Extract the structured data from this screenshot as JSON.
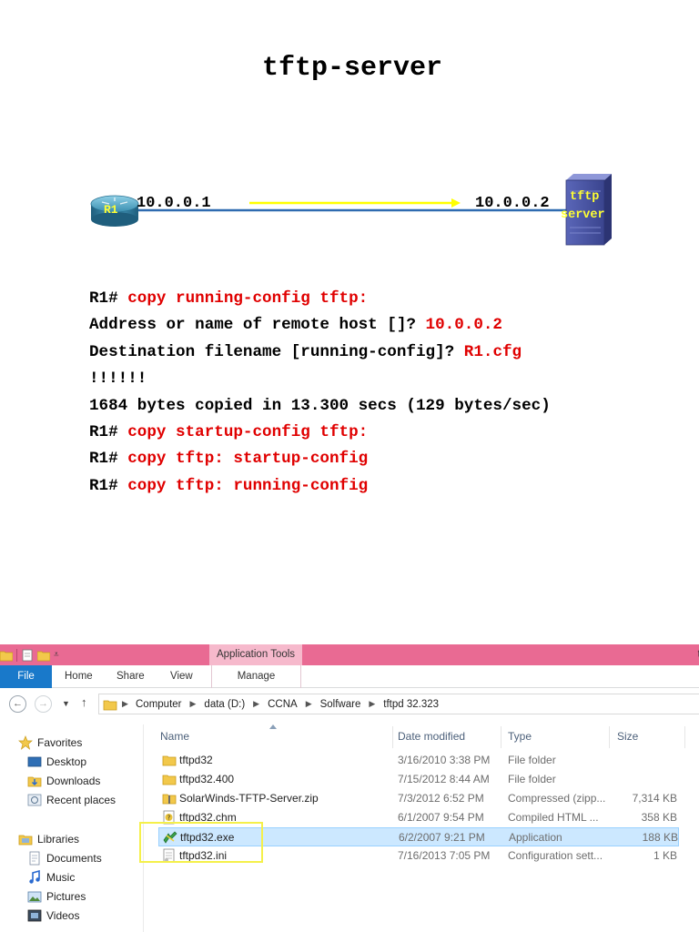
{
  "slide": {
    "title": "tftp-server",
    "diagram": {
      "router_label": "R1",
      "router_ip": "10.0.0.1",
      "server_ip": "10.0.0.2",
      "server_label_line1": "tftp",
      "server_label_line2": "server",
      "link_color": "#2f6bb0",
      "arrow_color": "#ffff00"
    },
    "cli": [
      {
        "prompt": "R1# ",
        "text": "copy running-config tftp:",
        "style": "command"
      },
      {
        "prompt": "Address or name of remote host []? ",
        "text": "10.0.0.2",
        "style": "command"
      },
      {
        "prompt": "Destination filename [running-config]? ",
        "text": "R1.cfg",
        "style": "command"
      },
      {
        "prompt": "!!!!!!",
        "text": "",
        "style": "output"
      },
      {
        "prompt": "1684 bytes copied in 13.300 secs (129 bytes/sec)",
        "text": "",
        "style": "output"
      },
      {
        "prompt": "R1# ",
        "text": "copy startup-config tftp:",
        "style": "command"
      },
      {
        "prompt": "R1# ",
        "text": "copy tftp: startup-config",
        "style": "command"
      },
      {
        "prompt": "R1# ",
        "text": "copy tftp: running-config",
        "style": "command"
      }
    ]
  },
  "explorer": {
    "context_tab": "Application Tools",
    "title_tail": "t",
    "ribbon_tabs": {
      "file": "File",
      "home": "Home",
      "share": "Share",
      "view": "View",
      "manage": "Manage"
    },
    "breadcrumbs": [
      "Computer",
      "data (D:)",
      "CCNA",
      "Solfware",
      "tftpd 32.323"
    ],
    "nav": {
      "favorites": "Favorites",
      "desktop": "Desktop",
      "downloads": "Downloads",
      "recent": "Recent places",
      "libraries": "Libraries",
      "documents": "Documents",
      "music": "Music",
      "pictures": "Pictures",
      "videos": "Videos"
    },
    "columns": {
      "name": "Name",
      "date": "Date modified",
      "type": "Type",
      "size": "Size"
    },
    "files": [
      {
        "name": "tftpd32",
        "date": "3/16/2010 3:38 PM",
        "type": "File folder",
        "size": "",
        "icon": "folder-icon",
        "selected": false
      },
      {
        "name": "tftpd32.400",
        "date": "7/15/2012 8:44 AM",
        "type": "File folder",
        "size": "",
        "icon": "folder-icon",
        "selected": false
      },
      {
        "name": "SolarWinds-TFTP-Server.zip",
        "date": "7/3/2012 6:52 PM",
        "type": "Compressed (zipp...",
        "size": "7,314 KB",
        "icon": "zip-folder-icon",
        "selected": false
      },
      {
        "name": "tftpd32.chm",
        "date": "6/1/2007 9:54 PM",
        "type": "Compiled HTML ...",
        "size": "358 KB",
        "icon": "help-file-icon",
        "selected": false
      },
      {
        "name": "tftpd32.exe",
        "date": "6/2/2007 9:21 PM",
        "type": "Application",
        "size": "188 KB",
        "icon": "application-icon",
        "selected": true
      },
      {
        "name": "tftpd32.ini",
        "date": "7/16/2013 7:05 PM",
        "type": "Configuration sett...",
        "size": "1 KB",
        "icon": "settings-file-icon",
        "selected": false
      }
    ],
    "colors": {
      "titlebar": "#e96a93",
      "file_tab": "#1979ca",
      "selection": "#cce8ff",
      "highlight_box": "#f5f04a"
    }
  }
}
